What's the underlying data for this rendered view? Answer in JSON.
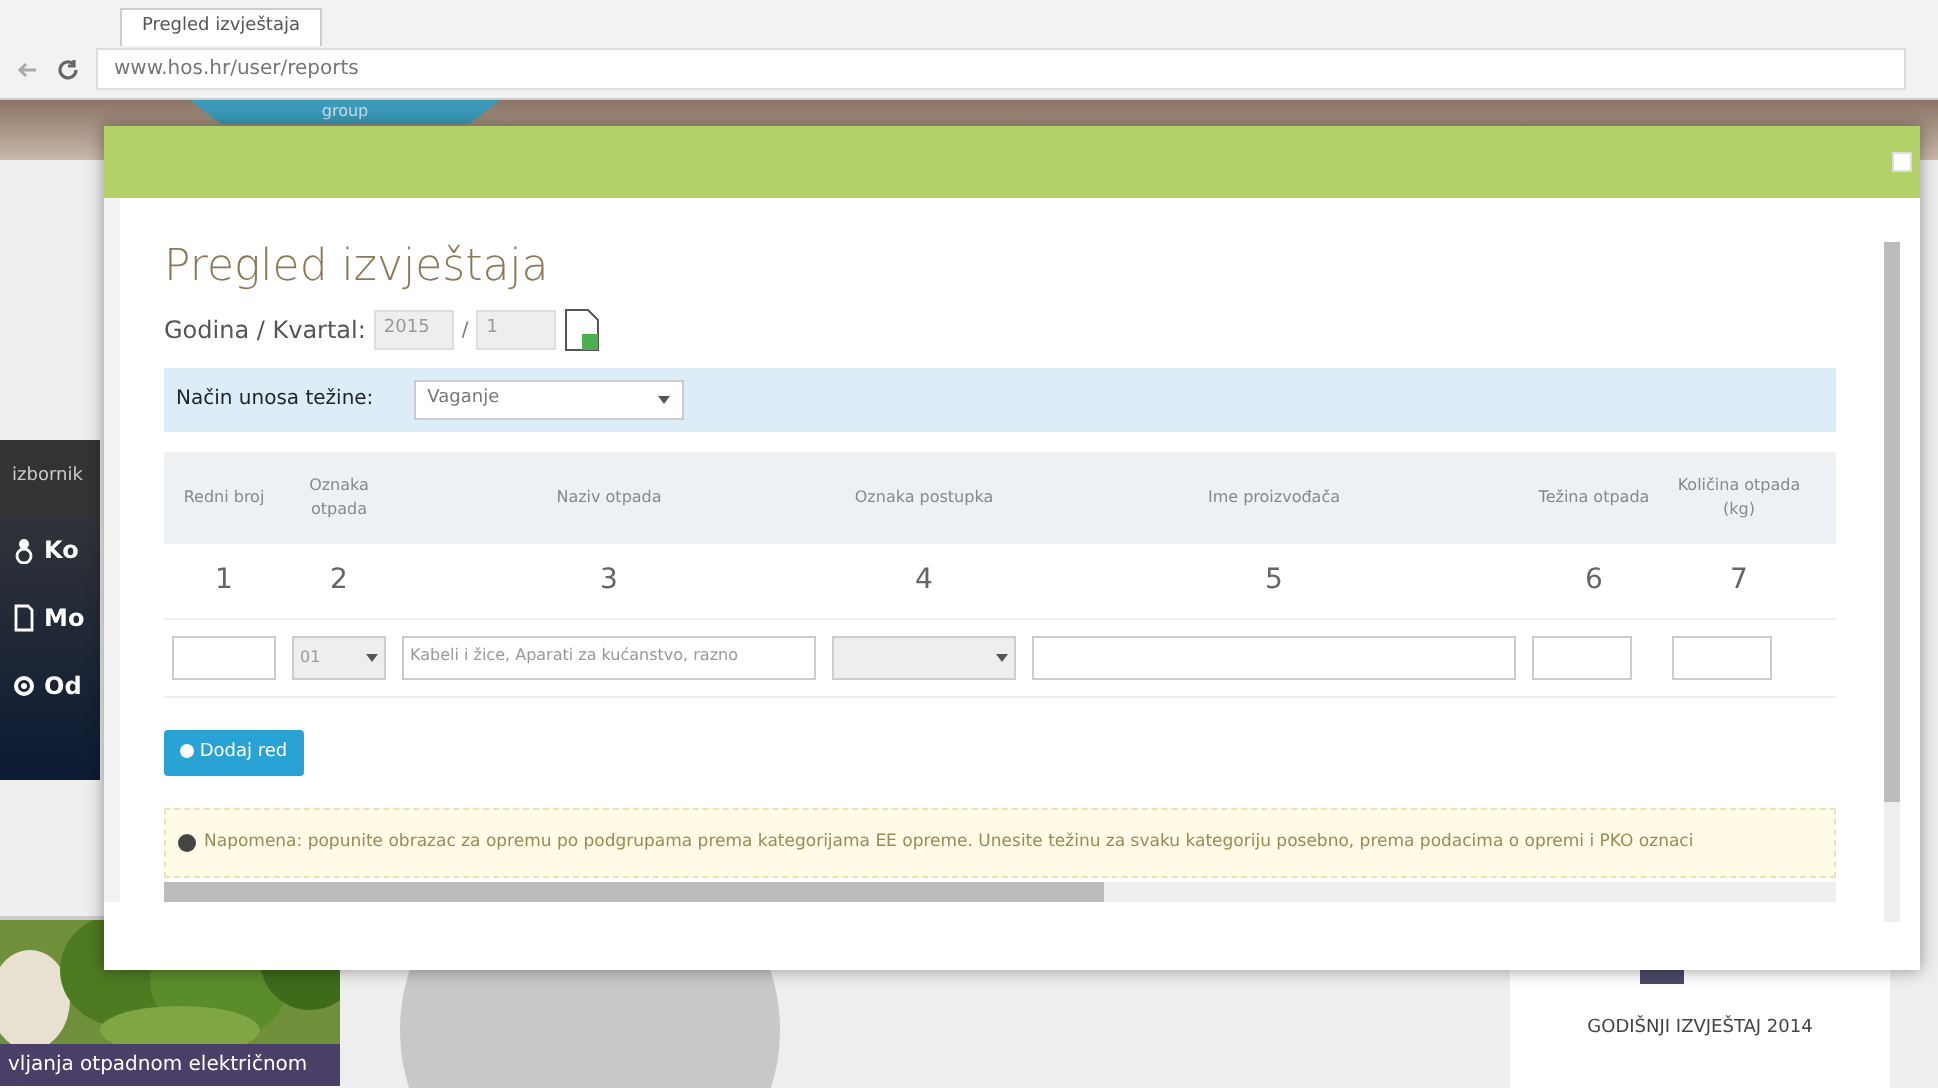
{
  "browser": {
    "tab_title": "Pregled izvještaja",
    "url": "www.hos.hr/user/reports"
  },
  "background": {
    "site_tab": "group",
    "sidebar_header": "izbornik",
    "sidebar_items": [
      {
        "label": "Ko"
      },
      {
        "label": "Mo"
      },
      {
        "label": "Od"
      }
    ],
    "news_caption": "vljanja otpadnom električnom",
    "report_title": "GODIŠNJI IZVJEŠTAJ 2014"
  },
  "modal": {
    "title": "Pregled izvještaja",
    "period_label": "Godina / Kvartal:",
    "year": "2015",
    "separator": "/",
    "quarter": "1",
    "filter": {
      "label": "Način unosa težine:",
      "value": "Vaganje"
    },
    "table": {
      "columns": [
        {
          "header": "Redni broj",
          "number": "1"
        },
        {
          "header": "Oznaka otpada",
          "number": "2"
        },
        {
          "header": "Naziv otpada",
          "number": "3"
        },
        {
          "header": "Oznaka postupka",
          "number": "4"
        },
        {
          "header": "Ime proizvođača",
          "number": "5"
        },
        {
          "header": "Težina otpada",
          "number": "6"
        },
        {
          "header": "Količina otpada (kg)",
          "number": "7"
        }
      ],
      "row": {
        "waste_code": "01",
        "waste_name": "Kabeli i žice, Aparati za kućanstvo, razno"
      }
    },
    "add_button": "Dodaj red",
    "note": "Napomena: popunite obrazac za opremu po podgrupama prema kategorijama EE opreme. Unesite težinu za svaku kategoriju posebno, prema podacima o opremi i PKO oznaci"
  }
}
